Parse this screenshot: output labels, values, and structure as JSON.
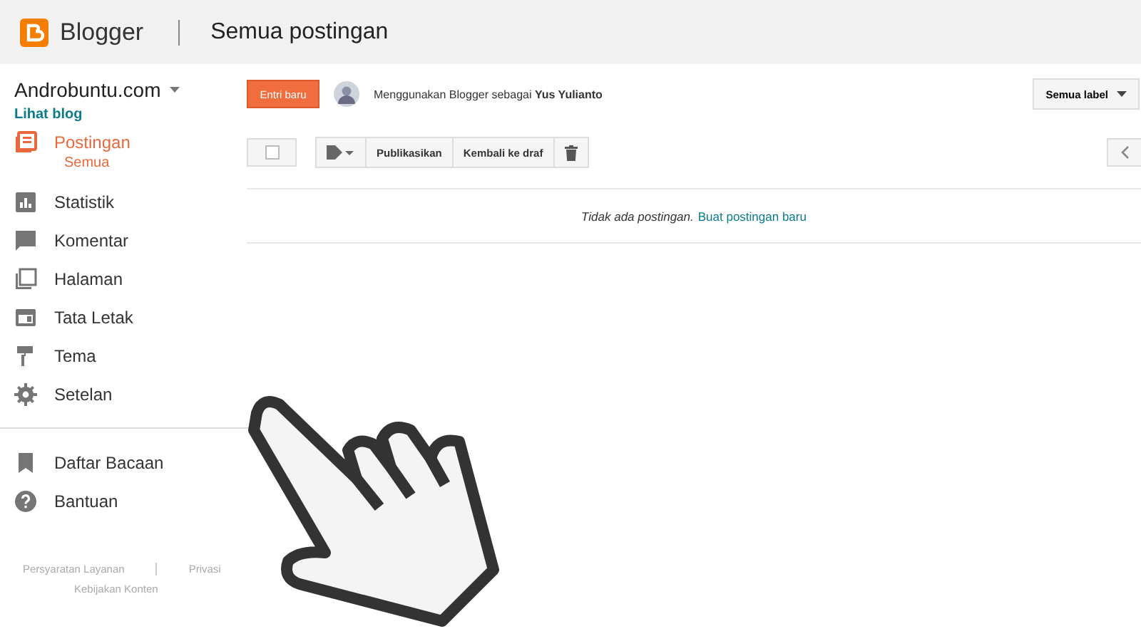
{
  "header": {
    "brand": "Blogger",
    "title": "Semua postingan"
  },
  "sidebar": {
    "blog_name": "Androbuntu.com",
    "view_blog": "Lihat blog",
    "items": [
      {
        "label": "Postingan",
        "kind": "posts",
        "selected": true,
        "children": [
          {
            "label": "Semua",
            "selected": true
          }
        ]
      },
      {
        "label": "Statistik",
        "kind": "stats",
        "selected": false
      },
      {
        "label": "Komentar",
        "kind": "comments",
        "selected": false
      },
      {
        "label": "Halaman",
        "kind": "pages",
        "selected": false
      },
      {
        "label": "Tata Letak",
        "kind": "layout",
        "selected": false
      },
      {
        "label": "Tema",
        "kind": "theme",
        "selected": false
      },
      {
        "label": "Setelan",
        "kind": "settings",
        "selected": false
      }
    ],
    "secondary_items": [
      {
        "label": "Daftar Bacaan",
        "kind": "bookmark"
      },
      {
        "label": "Bantuan",
        "kind": "help"
      }
    ],
    "footer_links": [
      "Persyaratan Layanan",
      "Privasi",
      "Kebijakan Konten"
    ]
  },
  "toolbar": {
    "new_post": "Entri baru",
    "user_text": "Menggunakan Blogger sebagai **Yus Yulianto**",
    "label_filter": "Semua label"
  },
  "actions": {
    "checked": false,
    "publish": "Publikasikan",
    "revert": "Kembali ke draf"
  },
  "empty": {
    "message": "Tidak ada postingan.",
    "link": "Buat postingan baru"
  }
}
